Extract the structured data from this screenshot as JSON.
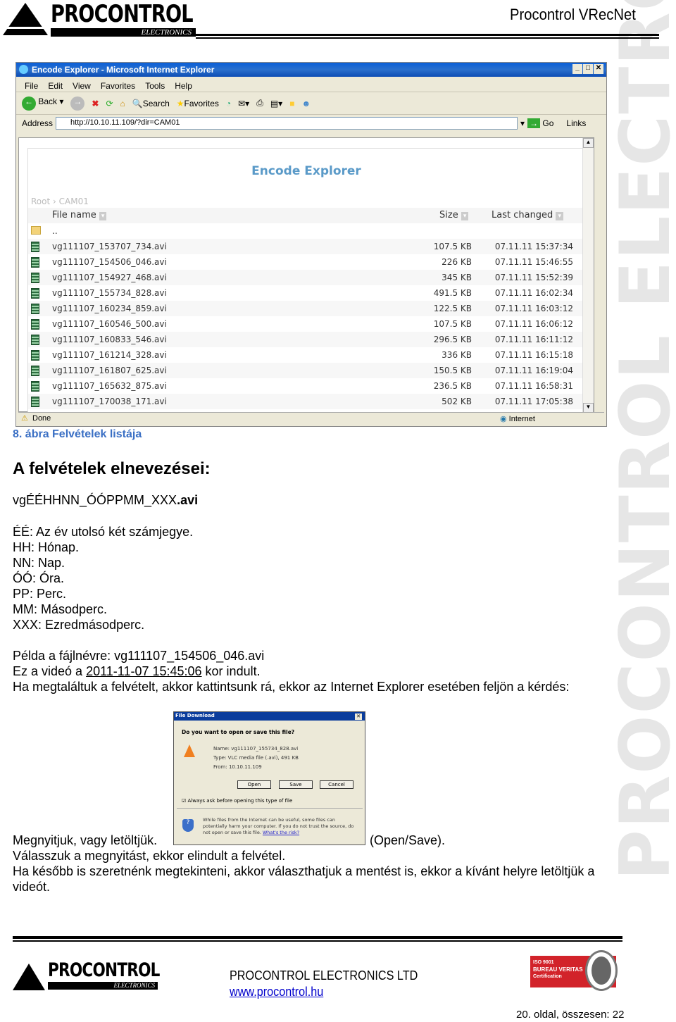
{
  "header": {
    "logo_text": "PROCONTROL",
    "logo_sub": "ELECTRONICS",
    "doc_title": "Procontrol VRecNet"
  },
  "watermark": "PROCONTROL ELECTRONICS LTD.",
  "browser": {
    "title": "Encode Explorer - Microsoft Internet Explorer",
    "menu": [
      "File",
      "Edit",
      "View",
      "Favorites",
      "Tools",
      "Help"
    ],
    "toolbar": {
      "back": "Back",
      "search": "Search",
      "favorites": "Favorites"
    },
    "address_label": "Address",
    "address": "http://10.10.11.109/?dir=CAM01",
    "go": "Go",
    "links": "Links",
    "page_title": "Encode Explorer",
    "breadcrumb": [
      "Root",
      "CAM01"
    ],
    "columns": {
      "name": "File name",
      "size": "Size",
      "changed": "Last changed"
    },
    "parent": "..",
    "files": [
      {
        "name": "vg111107_153707_734.avi",
        "size": "107.5 KB",
        "date": "07.11.11 15:37:34"
      },
      {
        "name": "vg111107_154506_046.avi",
        "size": "226 KB",
        "date": "07.11.11 15:46:55"
      },
      {
        "name": "vg111107_154927_468.avi",
        "size": "345 KB",
        "date": "07.11.11 15:52:39"
      },
      {
        "name": "vg111107_155734_828.avi",
        "size": "491.5 KB",
        "date": "07.11.11 16:02:34"
      },
      {
        "name": "vg111107_160234_859.avi",
        "size": "122.5 KB",
        "date": "07.11.11 16:03:12"
      },
      {
        "name": "vg111107_160546_500.avi",
        "size": "107.5 KB",
        "date": "07.11.11 16:06:12"
      },
      {
        "name": "vg111107_160833_546.avi",
        "size": "296.5 KB",
        "date": "07.11.11 16:11:12"
      },
      {
        "name": "vg111107_161214_328.avi",
        "size": "336 KB",
        "date": "07.11.11 16:15:18"
      },
      {
        "name": "vg111107_161807_625.avi",
        "size": "150.5 KB",
        "date": "07.11.11 16:19:04"
      },
      {
        "name": "vg111107_165632_875.avi",
        "size": "236.5 KB",
        "date": "07.11.11 16:58:31"
      },
      {
        "name": "vg111107_170038_171.avi",
        "size": "502 KB",
        "date": "07.11.11 17:05:38"
      }
    ],
    "status": "Done",
    "zone": "Internet"
  },
  "caption": "8. ábra Felvételek listája",
  "heading": "A felvételek elnevezései:",
  "pattern": {
    "main": "vgÉÉHHNN_ÓÓPPMM_XXX",
    "ext": ".avi"
  },
  "legend": [
    "ÉÉ: Az év utolsó két számjegye.",
    "HH: Hónap.",
    "NN: Nap.",
    "ÓÓ: Óra.",
    "PP: Perc.",
    "MM: Másodperc.",
    "XXX: Ezredmásodperc."
  ],
  "example": {
    "line1": "Példa a fájlnévre: vg111107_154506_046.avi",
    "line2_pre": "Ez a videó a ",
    "line2_date": "2011-11-07 15:45:06",
    "line2_post": " kor indult.",
    "line3": "Ha megtaláltuk a felvételt, akkor kattintsunk rá, ekkor az Internet Explorer esetében feljön a kérdés:"
  },
  "dialog": {
    "title": "File Download",
    "question": "Do you want to open or save this file?",
    "name_label": "Name:",
    "name": "vg111107_155734_828.avi",
    "type_label": "Type:",
    "type": "VLC media file (.avi), 491 KB",
    "from_label": "From:",
    "from": "10.10.11.109",
    "open": "Open",
    "save": "Save",
    "cancel": "Cancel",
    "always_ask": "Always ask before opening this type of file",
    "warning": "While files from the Internet can be useful, some files can potentially harm your computer. If you do not trust the source, do not open or save this file.",
    "risk_link": "What's the risk?"
  },
  "after": {
    "left": "Megnyitjuk, vagy letöltjük.",
    "right": "(Open/Save).",
    "line2": "Válasszuk a megnyitást, ekkor elindult a felvétel.",
    "line3": "Ha később is szeretnénk megtekinteni, akkor választhatjuk a mentést is, ekkor a kívánt helyre letöltjük a",
    "line4": "videót."
  },
  "footer": {
    "company": "PROCONTROL ELECTRONICS LTD",
    "url": "www.procontrol.hu",
    "cert": [
      "ISO 9001",
      "BUREAU VERITAS",
      "Certification"
    ],
    "cert_seal": "BUREAU VERITAS 1828",
    "page": "20. oldal, összesen: 22"
  }
}
